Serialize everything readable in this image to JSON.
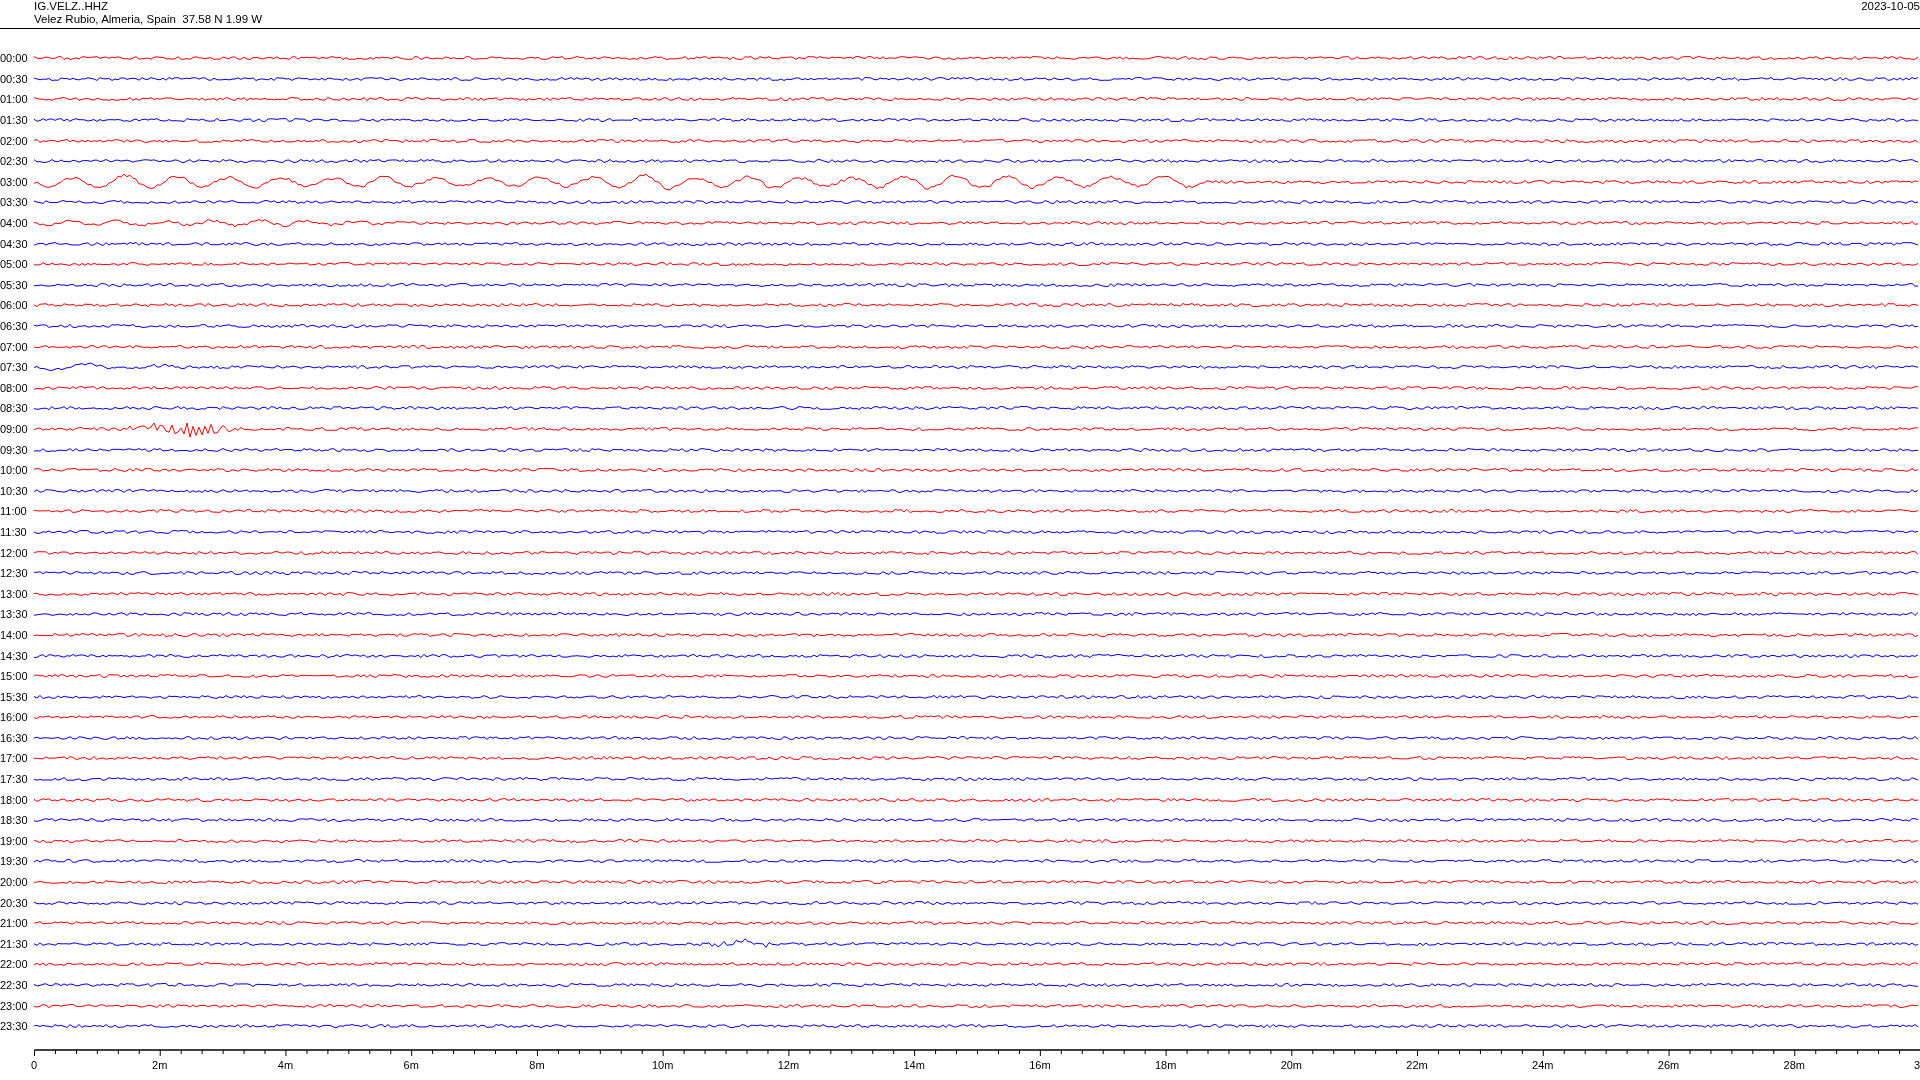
{
  "header": {
    "station": "IG.VELZ..HHZ",
    "location": "Velez Rubio, Almeria, Spain  37.58 N 1.99 W",
    "date": "2023-10-05"
  },
  "traces": [
    {
      "label": "00:00",
      "color": "#ff0000"
    },
    {
      "label": "00:30",
      "color": "#0000ff"
    },
    {
      "label": "01:00",
      "color": "#ff0000"
    },
    {
      "label": "01:30",
      "color": "#0000ff"
    },
    {
      "label": "02:00",
      "color": "#ff0000"
    },
    {
      "label": "02:30",
      "color": "#0000ff"
    },
    {
      "label": "03:00",
      "color": "#ff0000"
    },
    {
      "label": "03:30",
      "color": "#0000ff"
    },
    {
      "label": "04:00",
      "color": "#ff0000"
    },
    {
      "label": "04:30",
      "color": "#0000ff"
    },
    {
      "label": "05:00",
      "color": "#ff0000"
    },
    {
      "label": "05:30",
      "color": "#0000ff"
    },
    {
      "label": "06:00",
      "color": "#ff0000"
    },
    {
      "label": "06:30",
      "color": "#0000ff"
    },
    {
      "label": "07:00",
      "color": "#ff0000"
    },
    {
      "label": "07:30",
      "color": "#0000ff"
    },
    {
      "label": "08:00",
      "color": "#ff0000"
    },
    {
      "label": "08:30",
      "color": "#0000ff"
    },
    {
      "label": "09:00",
      "color": "#ff0000"
    },
    {
      "label": "09:30",
      "color": "#0000ff"
    },
    {
      "label": "10:00",
      "color": "#ff0000"
    },
    {
      "label": "10:30",
      "color": "#0000ff"
    },
    {
      "label": "11:00",
      "color": "#ff0000"
    },
    {
      "label": "11:30",
      "color": "#0000ff"
    },
    {
      "label": "12:00",
      "color": "#ff0000"
    },
    {
      "label": "12:30",
      "color": "#0000ff"
    },
    {
      "label": "13:00",
      "color": "#ff0000"
    },
    {
      "label": "13:30",
      "color": "#0000ff"
    },
    {
      "label": "14:00",
      "color": "#ff0000"
    },
    {
      "label": "14:30",
      "color": "#0000ff"
    },
    {
      "label": "15:00",
      "color": "#ff0000"
    },
    {
      "label": "15:30",
      "color": "#0000ff"
    },
    {
      "label": "16:00",
      "color": "#ff0000"
    },
    {
      "label": "16:30",
      "color": "#0000ff"
    },
    {
      "label": "17:00",
      "color": "#ff0000"
    },
    {
      "label": "17:30",
      "color": "#0000ff"
    },
    {
      "label": "18:00",
      "color": "#ff0000"
    },
    {
      "label": "18:30",
      "color": "#0000ff"
    },
    {
      "label": "19:00",
      "color": "#ff0000"
    },
    {
      "label": "19:30",
      "color": "#0000ff"
    },
    {
      "label": "20:00",
      "color": "#ff0000"
    },
    {
      "label": "20:30",
      "color": "#0000ff"
    },
    {
      "label": "21:00",
      "color": "#ff0000"
    },
    {
      "label": "21:30",
      "color": "#0000ff"
    },
    {
      "label": "22:00",
      "color": "#ff0000"
    },
    {
      "label": "22:30",
      "color": "#0000ff"
    },
    {
      "label": "23:00",
      "color": "#ff0000"
    },
    {
      "label": "23:30",
      "color": "#0000ff"
    }
  ],
  "axis": {
    "tick_labels": [
      "0",
      "2m",
      "4m",
      "6m",
      "8m",
      "10m",
      "12m",
      "14m",
      "16m",
      "18m",
      "20m",
      "22m",
      "24m",
      "26m",
      "28m",
      "3"
    ]
  }
}
